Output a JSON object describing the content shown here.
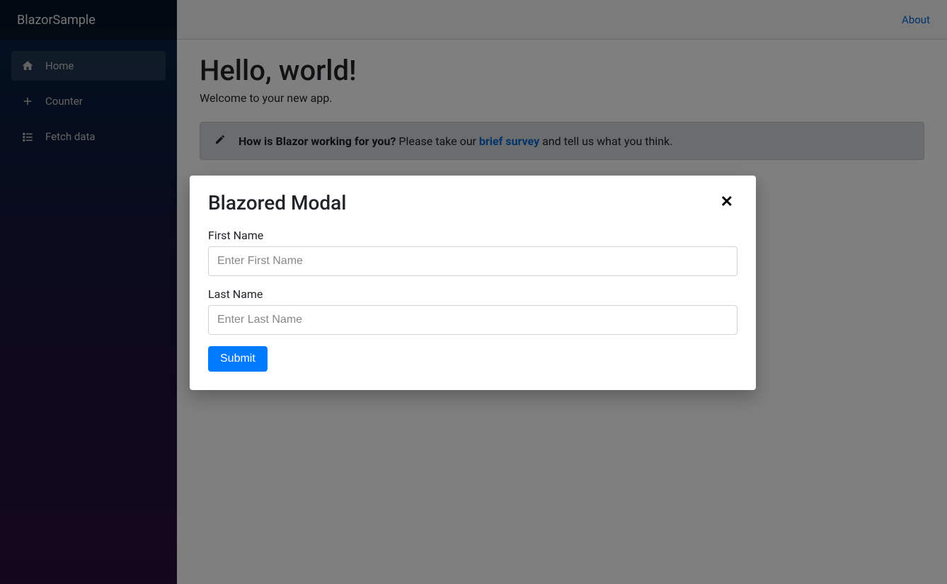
{
  "sidebar": {
    "brand": "BlazorSample",
    "items": [
      {
        "label": "Home"
      },
      {
        "label": "Counter"
      },
      {
        "label": "Fetch data"
      }
    ]
  },
  "header": {
    "about_link": "About"
  },
  "main": {
    "heading": "Hello, world!",
    "welcome": "Welcome to your new app.",
    "survey": {
      "question": "How is Blazor working for you?",
      "prefix": " Please take our ",
      "link_text": "brief survey",
      "suffix": " and tell us what you think."
    }
  },
  "modal": {
    "title": "Blazored Modal",
    "close_glyph": "✕",
    "first_name_label": "First Name",
    "first_name_placeholder": "Enter First Name",
    "last_name_label": "Last Name",
    "last_name_placeholder": "Enter Last Name",
    "submit_label": "Submit"
  }
}
